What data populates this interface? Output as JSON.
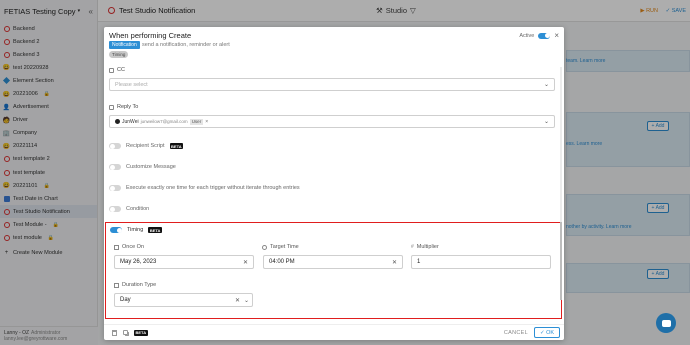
{
  "sidebar": {
    "app_title": "FETIAS Testing Copy",
    "caret": "▾",
    "collapse": "«",
    "items": [
      {
        "label": "Backend",
        "icon": "red-circle-icon"
      },
      {
        "label": "Backend 2",
        "icon": "red-circle-icon"
      },
      {
        "label": "Backend 3",
        "icon": "red-circle-icon"
      },
      {
        "label": "test 20220928",
        "icon": "face-emoji-icon"
      },
      {
        "label": "Element Section",
        "icon": "blue-diamond-icon"
      },
      {
        "label": "20221006",
        "icon": "face-emoji-icon",
        "locked": true
      },
      {
        "label": "Advertisement",
        "icon": "person-emoji-icon"
      },
      {
        "label": "Driver",
        "icon": "driver-emoji-icon"
      },
      {
        "label": "Company",
        "icon": "building-emoji-icon"
      },
      {
        "label": "20221114",
        "icon": "face-emoji-icon"
      },
      {
        "label": "test template 2",
        "icon": "red-circle-icon"
      },
      {
        "label": "test template",
        "icon": "red-circle-icon"
      },
      {
        "label": "20221101",
        "icon": "face-emoji-icon",
        "locked": true
      },
      {
        "label": "Test Date in Chart",
        "icon": "blue-square-icon"
      },
      {
        "label": "Test Studio Notification",
        "icon": "red-circle-icon",
        "active": true
      },
      {
        "label": "Test Module -",
        "icon": "red-circle-icon",
        "locked": true
      },
      {
        "label": "test module",
        "icon": "red-circle-icon",
        "locked": true
      }
    ],
    "create_label": "Create New Module",
    "create_icon": "+",
    "user_name": "Lanny - OZ",
    "user_role": "Administrator",
    "user_email": "lanny.lee@greyrottware.com",
    "lock_glyph": "🔒"
  },
  "topbar": {
    "title": "Test Studio Notification",
    "studio_label": "Studio",
    "studio_icon": "⚒",
    "studio_caret": "▽",
    "run_label": "▶ RUN",
    "save_label": "✓ SAVE"
  },
  "background": {
    "link1": "team. Learn more",
    "link2": "ess. Learn more",
    "link3": "nother by activity. Learn more",
    "add_label": "+ Add"
  },
  "modal": {
    "title": "When performing Create",
    "badge": "Notification",
    "description": "send a notification, reminder or alert",
    "timing_tag": "Timing",
    "active_label": "Active",
    "close_glyph": "×",
    "cc_label": "CC",
    "cc_placeholder": "Please select",
    "reply_label": "Reply To",
    "reply_name": "JunWei",
    "reply_email": "junweilow7@gmail.com",
    "reply_tag": "User",
    "reply_x": "×",
    "chev": "⌄",
    "opt_recipient": "Recipient Script",
    "opt_customize": "Customize Message",
    "opt_execute": "Execute exactly one time for each trigger without iterate through entries",
    "opt_condition": "Condition",
    "beta": "BETA",
    "timing_label": "Timing",
    "once_on_label": "Once On",
    "once_on_value": "May 26, 2023",
    "target_time_label": "Target Time",
    "target_time_value": "04:00 PM",
    "multiplier_label": "Multiplier",
    "multiplier_value": "1",
    "duration_label": "Duration Type",
    "duration_value": "Day",
    "cancel_label": "CANCEL",
    "ok_label": "✓ OK",
    "x_glyph": "✕"
  },
  "colors": {
    "accent": "#2d8fd5",
    "highlight_border": "#e01e1e",
    "run": "#e48a1c"
  }
}
